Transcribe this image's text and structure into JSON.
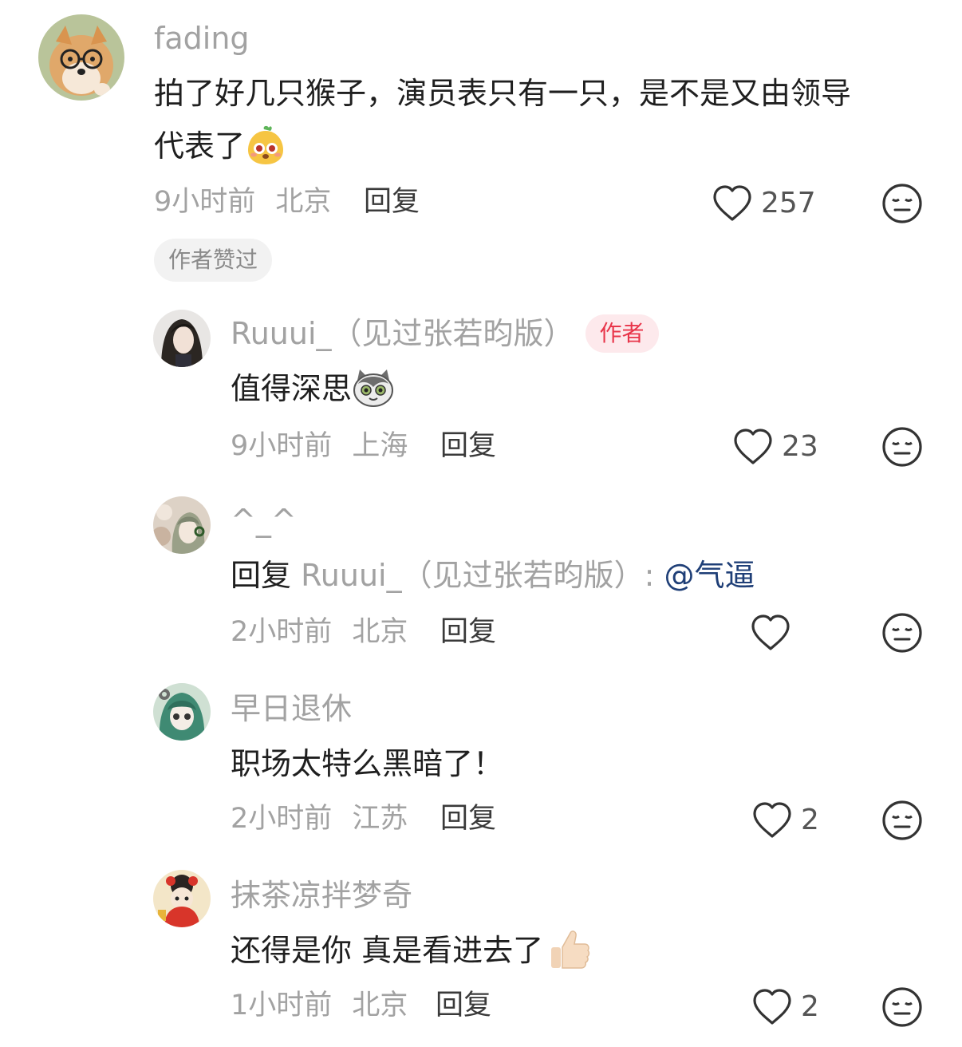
{
  "comments": [
    {
      "username": "fading",
      "content": [
        "拍了好几只猴子，演员表只有一只，是不是又由领导",
        "代表了"
      ],
      "emoji": "cute-face-emoji",
      "time": "9小时前",
      "location": "北京",
      "reply_label": "回复",
      "likes": "257",
      "tag": "作者赞过"
    },
    {
      "username": "Ruuui_（见过张若昀版）",
      "badge": "作者",
      "content": "值得深思",
      "emoji": "cat-emoji",
      "time": "9小时前",
      "location": "上海",
      "reply_label": "回复",
      "likes": "23"
    },
    {
      "username": "^_^",
      "reply_prefix": "回复",
      "reply_to": "Ruuui_（见过张若昀版）:",
      "mention": "@气逼",
      "time": "2小时前",
      "location": "北京",
      "reply_label": "回复",
      "likes": ""
    },
    {
      "username": "早日退休",
      "content": "职场太特么黑暗了！",
      "time": "2小时前",
      "location": "江苏",
      "reply_label": "回复",
      "likes": "2"
    },
    {
      "username": "抹茶凉拌梦奇",
      "content": "还得是你 真是看进去了",
      "emoji": "thumbs-up-emoji",
      "time": "1小时前",
      "location": "北京",
      "reply_label": "回复",
      "likes": "2"
    }
  ],
  "colors": {
    "username": "#a2a2a2",
    "text": "#1f1f1f",
    "author_badge_bg": "#fde9ec",
    "author_badge_text": "#e8354a",
    "mention": "#1f3f77"
  }
}
